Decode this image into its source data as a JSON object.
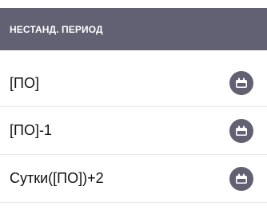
{
  "header": {
    "title": "НЕСТАНД. ПЕРИОД"
  },
  "items": [
    {
      "label": "[ПО]",
      "icon": "calendar-icon"
    },
    {
      "label": "[ПО]-1",
      "icon": "calendar-icon"
    },
    {
      "label": "Сутки([ПО])+2",
      "icon": "calendar-icon"
    }
  ],
  "colors": {
    "header_bg": "#626173",
    "header_text": "#ffffff",
    "icon_bg": "#626173",
    "divider": "#e8e8ea"
  }
}
